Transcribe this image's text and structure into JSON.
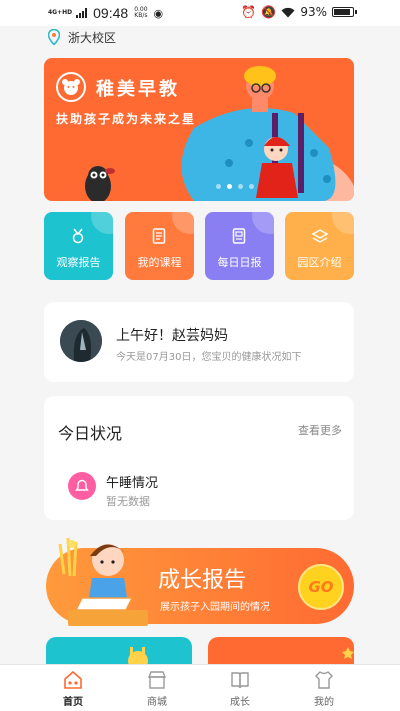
{
  "status_bar": {
    "network": "4G+HD",
    "time": "09:48",
    "speed_value": "0.00",
    "speed_unit": "KB/s",
    "battery": "93%"
  },
  "location": {
    "name": "浙大校区",
    "icon": "location-pin-icon"
  },
  "banner": {
    "title": "稚美早教",
    "subtitle": "扶助孩子成为未来之星",
    "page_count": 4,
    "active_page": 1
  },
  "quick_actions": [
    {
      "label": "观察报告",
      "icon": "medal-icon",
      "color": "#1ec3d0"
    },
    {
      "label": "我的课程",
      "icon": "document-icon",
      "color": "#ff7a3c"
    },
    {
      "label": "每日日报",
      "icon": "daily-report-icon",
      "color": "#8a7ff2"
    },
    {
      "label": "园区介绍",
      "icon": "layers-icon",
      "color": "#ffb04a"
    }
  ],
  "greeting": {
    "title": "上午好！赵芸妈妈",
    "subtitle": "今天是07月30日，您宝贝的健康状况如下"
  },
  "today_status": {
    "title": "今日状况",
    "more": "查看更多",
    "items": [
      {
        "title": "午睡情况",
        "value": "暂无数据",
        "icon": "bell-icon"
      }
    ]
  },
  "growth_report": {
    "title": "成长报告",
    "subtitle": "展示孩子入园期间的情况",
    "go_label": "GO"
  },
  "tabbar": [
    {
      "label": "首页",
      "icon": "home-icon",
      "active": true
    },
    {
      "label": "商城",
      "icon": "shop-icon",
      "active": false
    },
    {
      "label": "成长",
      "icon": "book-icon",
      "active": false
    },
    {
      "label": "我的",
      "icon": "clothes-icon",
      "active": false
    }
  ]
}
